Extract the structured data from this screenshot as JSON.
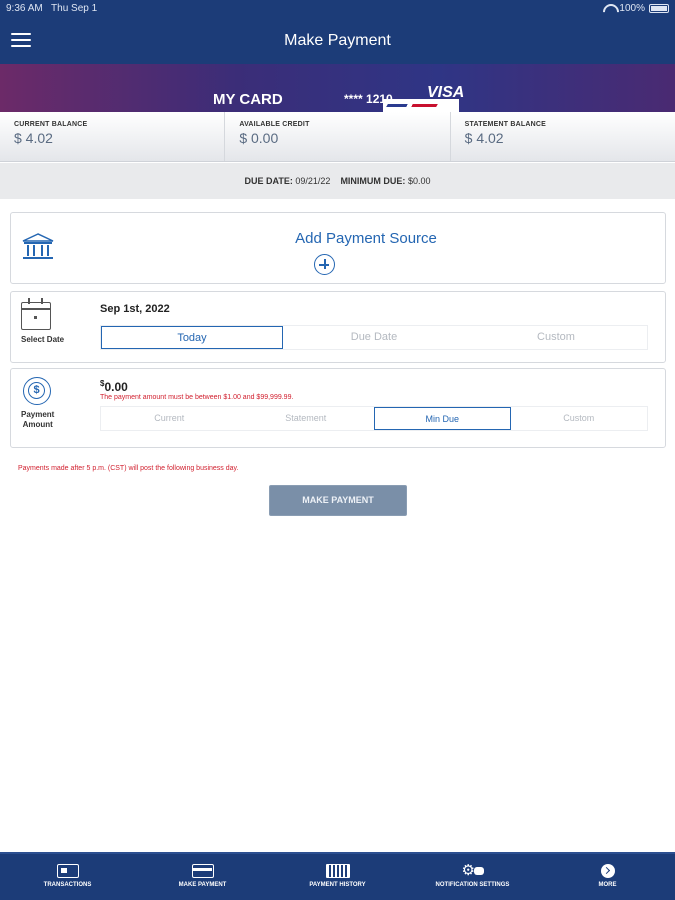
{
  "status_bar": {
    "time": "9:36 AM",
    "date": "Thu Sep 1",
    "battery": "100%"
  },
  "header": {
    "title": "Make Payment"
  },
  "card": {
    "name": "MY CARD",
    "number": "**** 1210",
    "brand": "VISA"
  },
  "balances": [
    {
      "label": "CURRENT BALANCE",
      "value": "$ 4.02"
    },
    {
      "label": "AVAILABLE CREDIT",
      "value": "$ 0.00"
    },
    {
      "label": "STATEMENT BALANCE",
      "value": "$ 4.02"
    }
  ],
  "due": {
    "date_label": "DUE DATE:",
    "date_value": "09/21/22",
    "min_label": "MINIMUM DUE:",
    "min_value": "$0.00"
  },
  "payment_source": {
    "label": "Add Payment Source"
  },
  "select_date": {
    "label": "Select Date",
    "value": "Sep 1st, 2022",
    "options": [
      "Today",
      "Due Date",
      "Custom"
    ],
    "selected": "Today"
  },
  "payment_amount": {
    "label_line1": "Payment",
    "label_line2": "Amount",
    "currency": "$",
    "value": "0.00",
    "error": "The payment amount must be between $1.00 and $99,999.99.",
    "options": [
      "Current",
      "Statement",
      "Min Due",
      "Custom"
    ],
    "selected": "Min Due"
  },
  "notice": "Payments made after 5 p.m. (CST) will post the following business day.",
  "submit": {
    "label": "MAKE PAYMENT"
  },
  "bottom_nav": [
    {
      "label": "TRANSACTIONS",
      "icon": "transactions-icon"
    },
    {
      "label": "MAKE PAYMENT",
      "icon": "card-icon"
    },
    {
      "label": "PAYMENT HISTORY",
      "icon": "history-icon"
    },
    {
      "label": "NOTIFICATION SETTINGS",
      "icon": "notification-settings-icon"
    },
    {
      "label": "MORE",
      "icon": "chevron-right-icon"
    }
  ],
  "colors": {
    "header": "#1c3c78",
    "accent": "#2466b2",
    "error": "#d11f2e",
    "button": "#7a8fa8"
  }
}
